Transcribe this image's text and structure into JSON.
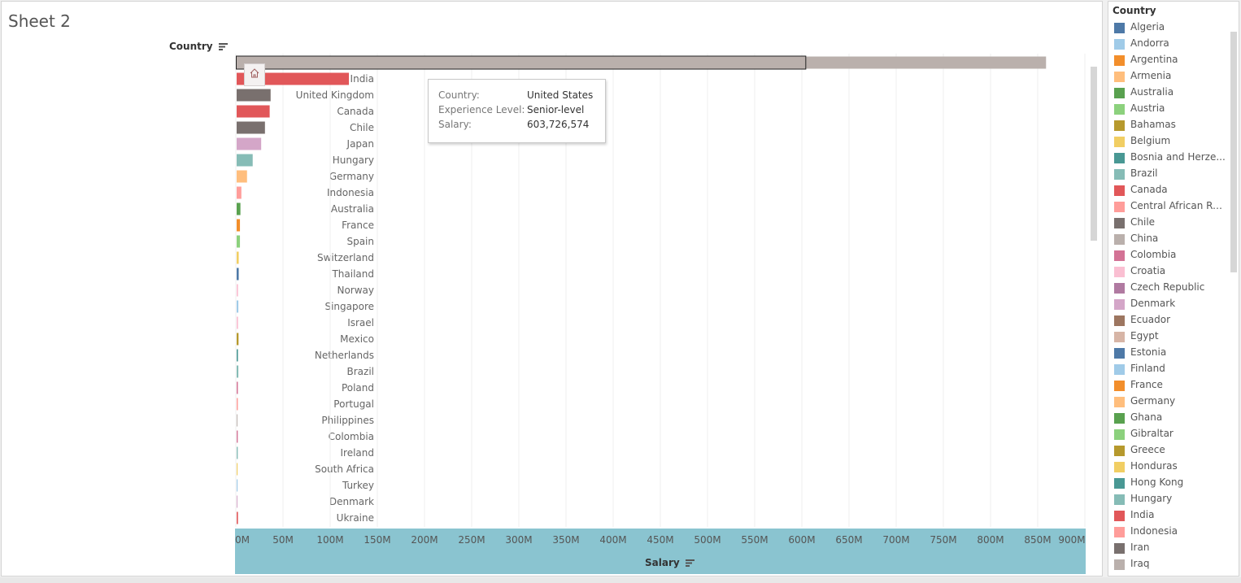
{
  "sheet": {
    "title": "Sheet 2"
  },
  "rows_header": {
    "label": "Country"
  },
  "axis": {
    "title": "Salary"
  },
  "tooltip": {
    "rows": [
      {
        "key": "Country:",
        "value": "United States"
      },
      {
        "key": "Experience Level:",
        "value": "Senior-level"
      },
      {
        "key": "Salary:",
        "value": "603,726,574"
      }
    ]
  },
  "home_icon": "home-icon",
  "chart_data": {
    "type": "bar",
    "orientation": "horizontal",
    "stacked": true,
    "xlabel": "Salary",
    "ylabel": "Country",
    "xlim": [
      0,
      900000000
    ],
    "x_ticks": [
      "0M",
      "50M",
      "100M",
      "150M",
      "200M",
      "250M",
      "300M",
      "350M",
      "400M",
      "450M",
      "500M",
      "550M",
      "600M",
      "650M",
      "700M",
      "750M",
      "800M",
      "850M",
      "900M"
    ],
    "grid": true,
    "legend_position": "right",
    "color_by": "Country",
    "categories": [
      "United States",
      "India",
      "United Kingdom",
      "Canada",
      "Chile",
      "Japan",
      "Hungary",
      "Germany",
      "Indonesia",
      "Australia",
      "France",
      "Spain",
      "Switzerland",
      "Thailand",
      "Norway",
      "Singapore",
      "Israel",
      "Mexico",
      "Netherlands",
      "Brazil",
      "Poland",
      "Portugal",
      "Philippines",
      "Colombia",
      "Ireland",
      "South Africa",
      "Turkey",
      "Denmark",
      "Ukraine"
    ],
    "values": [
      858000000,
      119000000,
      36000000,
      35000000,
      30000000,
      26000000,
      17000000,
      11000000,
      5000000,
      4000000,
      3500000,
      3500000,
      2200000,
      2200000,
      1500000,
      1800000,
      1500000,
      2000000,
      1400000,
      1800000,
      1300000,
      1300000,
      500000,
      1200000,
      1200000,
      1000000,
      1000000,
      400000,
      1400000
    ],
    "highlight": {
      "category": "United States",
      "series": "Senior-level",
      "value": 603726574
    },
    "colors": [
      "#bab0ac",
      "#e15759",
      "#79706e",
      "#e15759",
      "#79706e",
      "#d4a6c8",
      "#86bcb6",
      "#ffbe7d",
      "#ff9d9a",
      "#59a14f",
      "#f28e2b",
      "#8cd17d",
      "#f1ce63",
      "#4e79a7",
      "#fabfd2",
      "#a0cbe8",
      "#fabfd2",
      "#b6992d",
      "#499894",
      "#86bcb6",
      "#d37295",
      "#ff9d9a",
      "#bab0ac",
      "#d37295",
      "#86bcb6",
      "#f1ce63",
      "#a0cbe8",
      "#d4a6c8",
      "#e15759"
    ]
  },
  "legend": {
    "title": "Country",
    "items": [
      {
        "label": "Algeria",
        "color": "#4e79a7"
      },
      {
        "label": "Andorra",
        "color": "#a0cbe8"
      },
      {
        "label": "Argentina",
        "color": "#f28e2b"
      },
      {
        "label": "Armenia",
        "color": "#ffbe7d"
      },
      {
        "label": "Australia",
        "color": "#59a14f"
      },
      {
        "label": "Austria",
        "color": "#8cd17d"
      },
      {
        "label": "Bahamas",
        "color": "#b6992d"
      },
      {
        "label": "Belgium",
        "color": "#f1ce63"
      },
      {
        "label": "Bosnia and Herze...",
        "color": "#499894"
      },
      {
        "label": "Brazil",
        "color": "#86bcb6"
      },
      {
        "label": "Canada",
        "color": "#e15759"
      },
      {
        "label": "Central African Re...",
        "color": "#ff9d9a"
      },
      {
        "label": "Chile",
        "color": "#79706e"
      },
      {
        "label": "China",
        "color": "#bab0ac"
      },
      {
        "label": "Colombia",
        "color": "#d37295"
      },
      {
        "label": "Croatia",
        "color": "#fabfd2"
      },
      {
        "label": "Czech Republic",
        "color": "#b07aa1"
      },
      {
        "label": "Denmark",
        "color": "#d4a6c8"
      },
      {
        "label": "Ecuador",
        "color": "#9d7660"
      },
      {
        "label": "Egypt",
        "color": "#d7b5a6"
      },
      {
        "label": "Estonia",
        "color": "#4e79a7"
      },
      {
        "label": "Finland",
        "color": "#a0cbe8"
      },
      {
        "label": "France",
        "color": "#f28e2b"
      },
      {
        "label": "Germany",
        "color": "#ffbe7d"
      },
      {
        "label": "Ghana",
        "color": "#59a14f"
      },
      {
        "label": "Gibraltar",
        "color": "#8cd17d"
      },
      {
        "label": "Greece",
        "color": "#b6992d"
      },
      {
        "label": "Honduras",
        "color": "#f1ce63"
      },
      {
        "label": "Hong Kong",
        "color": "#499894"
      },
      {
        "label": "Hungary",
        "color": "#86bcb6"
      },
      {
        "label": "India",
        "color": "#e15759"
      },
      {
        "label": "Indonesia",
        "color": "#ff9d9a"
      },
      {
        "label": "Iran",
        "color": "#79706e"
      },
      {
        "label": "Iraq",
        "color": "#bab0ac"
      }
    ]
  }
}
